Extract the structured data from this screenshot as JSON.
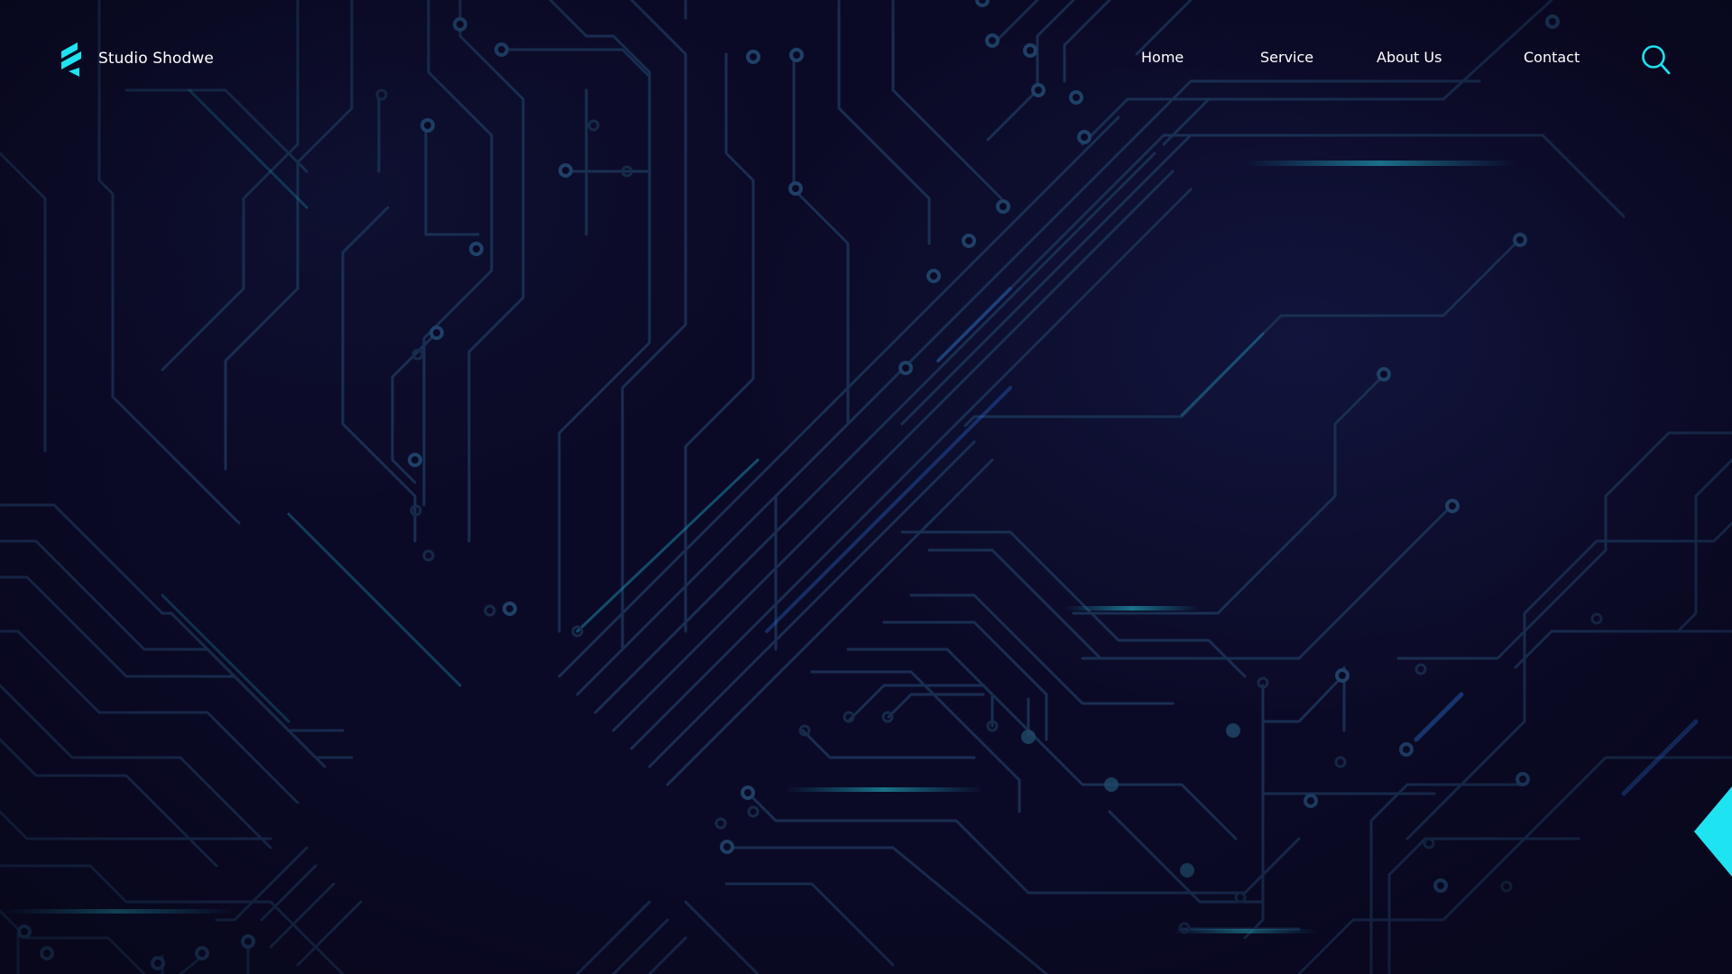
{
  "brand": {
    "name": "Studio Shodwe",
    "logo_icon": "stacked-chevron-logo-icon",
    "accent_color": "#1ee3f0"
  },
  "nav": {
    "items": [
      {
        "label": "Home"
      },
      {
        "label": "Service"
      },
      {
        "label": "About Us"
      },
      {
        "label": "Contact"
      }
    ],
    "search_icon": "search-icon"
  },
  "theme": {
    "background": "#0b0a26",
    "circuit_line": "#1d3a5c",
    "glow": "#1fb4d2"
  }
}
